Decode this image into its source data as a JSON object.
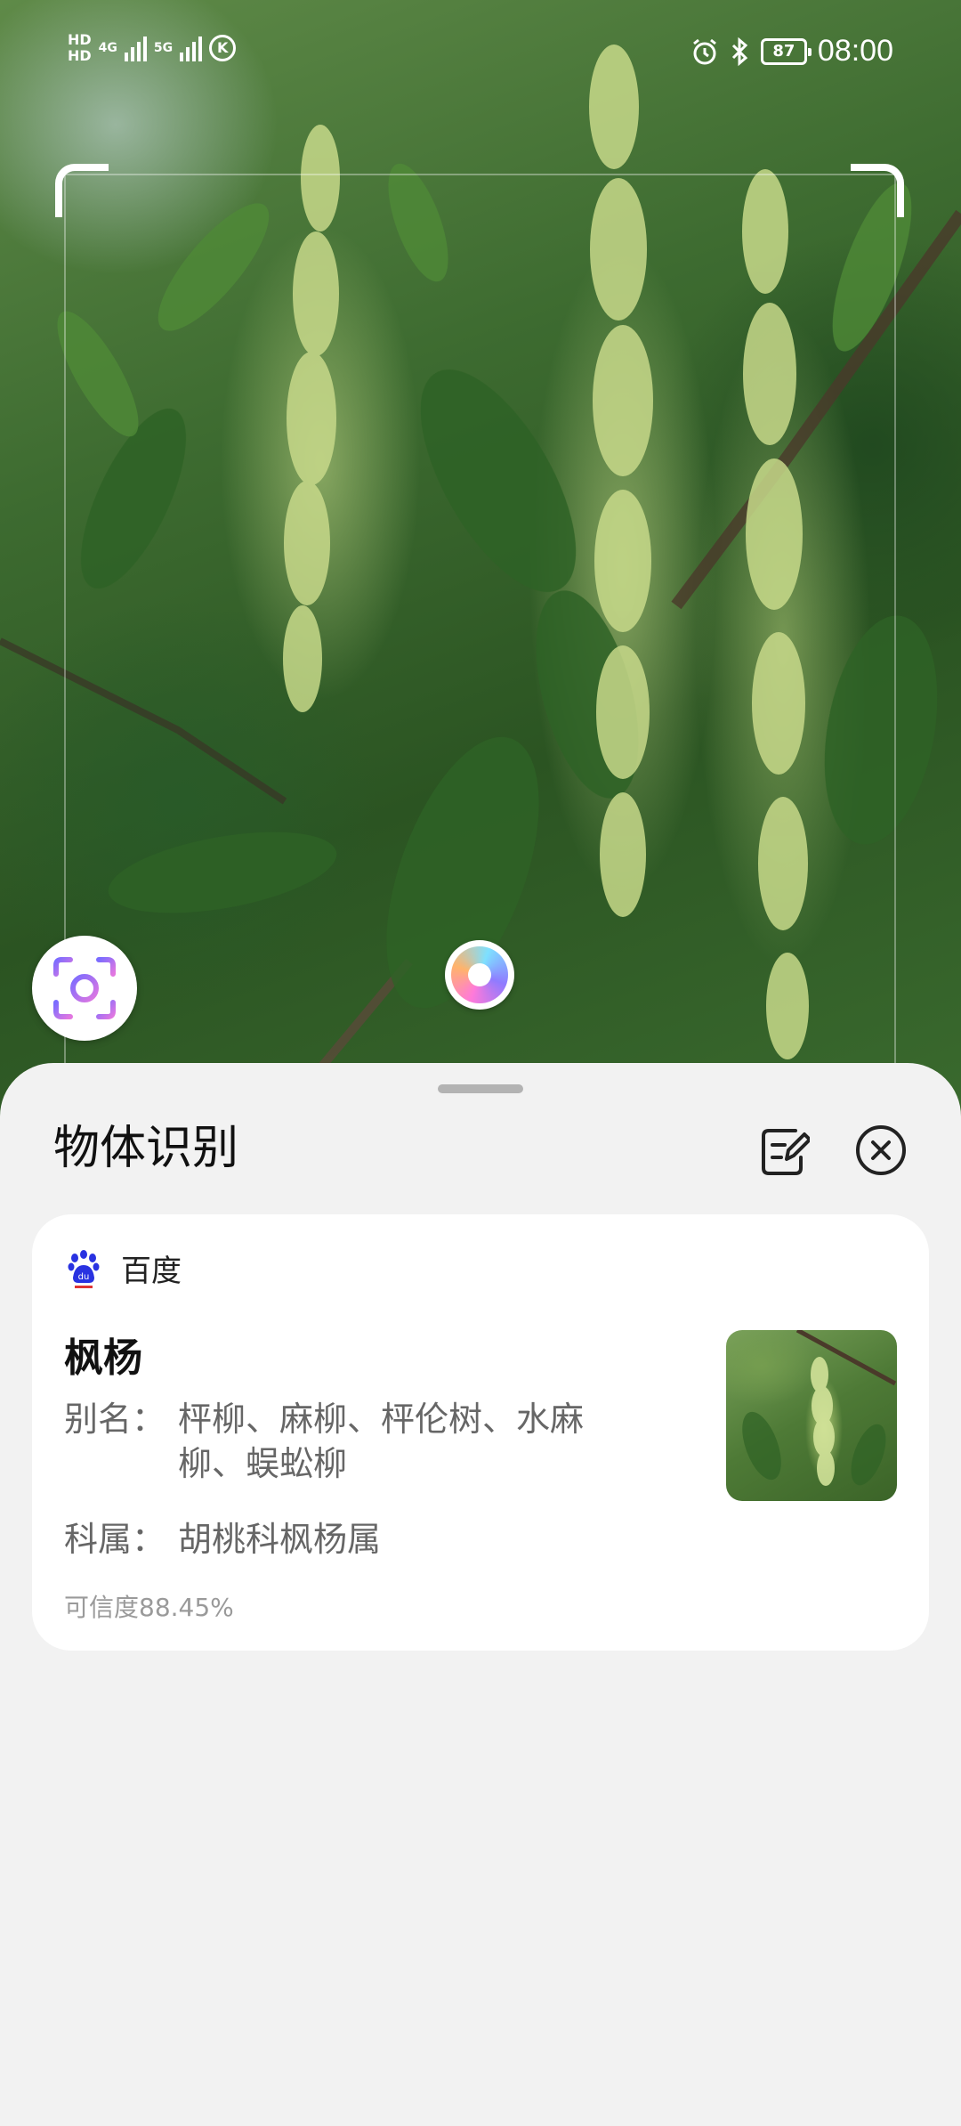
{
  "status_bar": {
    "network_hd1": "HD",
    "network_hd2": "HD",
    "network_gen1": "4G",
    "network_gen2": "5G",
    "battery": "87",
    "time": "08:00"
  },
  "sheet": {
    "title": "物体识别",
    "edit_icon": "edit-note-icon",
    "close_icon": "close-circle-icon"
  },
  "result": {
    "source": "百度",
    "source_icon": "baidu-paw-icon",
    "name": "枫杨",
    "alias_label": "别名：",
    "alias_value": "枰柳、麻柳、枰伦树、水麻柳、蜈蚣柳",
    "family_label": "科属：",
    "family_value": "胡桃科枫杨属",
    "confidence": "可信度88.45%"
  },
  "colors": {
    "sheet_bg": "#f2f2f2",
    "card_bg": "#ffffff",
    "title_text": "#111111",
    "secondary_text": "#666666",
    "baidu_blue": "#2932e1"
  }
}
